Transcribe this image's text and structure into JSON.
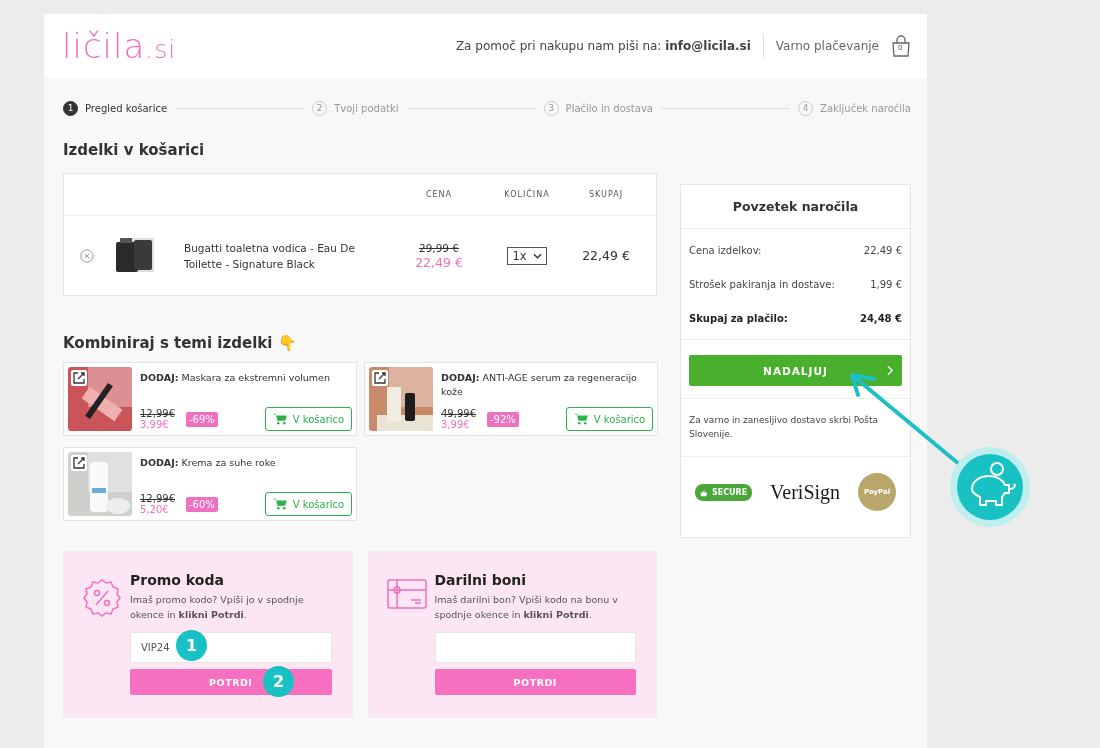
{
  "header": {
    "logo": {
      "name": "ličila",
      "suffix": ".si"
    },
    "help_text": "Za pomoč pri nakupu nam piši na:  **info@licila.si**",
    "secure_label": "Varno plačevanje",
    "cart_count": "0"
  },
  "steps": [
    {
      "number": "1",
      "label": "Pregled košarice",
      "selected": true
    },
    {
      "number": "2",
      "label": "Tvoji podatki",
      "selected": false
    },
    {
      "number": "3",
      "label": "Plačilo in dostava",
      "selected": false
    },
    {
      "number": "4",
      "label": "Zaključek naročila",
      "selected": false
    }
  ],
  "cart": {
    "title": "Izdelki v košarici",
    "columns": [
      "CENA",
      "KOLIČINA",
      "SKUPAJ"
    ],
    "rows": [
      {
        "name": "Bugatti toaletna vodica - Eau De Toilette - Signature Black",
        "old_price": "29,99 €",
        "price": "22,49 €",
        "quantity": "1x",
        "total": "22,49 €"
      }
    ]
  },
  "combine": {
    "title": "Kombiniraj s temi izdelki",
    "emoji": "👇",
    "items": [
      {
        "text": "**DODAJ:** Maskara za ekstremni volumen",
        "old_price": "12,99€",
        "price": "3,99€",
        "discount": "-69%",
        "button": "V košarico"
      },
      {
        "text": "**DODAJ:** ANTI-AGE serum za regeneracijo kože",
        "old_price": "49,99€",
        "price": "3,99€",
        "discount": "-92%",
        "button": "V košarico"
      },
      {
        "text": "**DODAJ:** Krema za suhe roke",
        "old_price": "12,99€",
        "price": "5,20€",
        "discount": "-60%",
        "button": "V košarico"
      }
    ]
  },
  "codes": [
    {
      "kind": "promo",
      "title": "Promo koda",
      "text": "Imaš promo kodo? Vpiši jo v spodnje okence in **klikni Potrdi**.",
      "value": "VIP24",
      "button": "POTRDI"
    },
    {
      "kind": "gift",
      "title": "Darilni boni",
      "text": "Imaš darilni bon? Vpiši kodo na bonu v spodnje okence in **klikni Potrdi**.",
      "button": "POTRDI"
    }
  ],
  "summary": {
    "title": "Povzetek naročila",
    "rows": [
      {
        "label": "Cena izdelkov:",
        "value": "22,49 €",
        "kind": "normal"
      },
      {
        "label": "Strošek pakiranja in dostave:",
        "value": "1,99 €",
        "kind": "normal"
      },
      {
        "label": "Skupaj za plačilo:",
        "value": "24,48 €",
        "kind": "total"
      }
    ],
    "button": "NADALJUJ",
    "delivery_note": "Za varno in zanesljivo dostavo skrbi Pošta Slovenije.",
    "trust_logos": [
      {
        "kind": "comodo",
        "text": "SECURE"
      },
      {
        "kind": "verisign",
        "text": "VeriSign"
      },
      {
        "kind": "paypal",
        "text": "PayPal"
      }
    ]
  },
  "annotations": [
    {
      "kind": "number",
      "text": "1"
    },
    {
      "kind": "number",
      "text": "2"
    },
    {
      "kind": "piggy"
    }
  ]
}
